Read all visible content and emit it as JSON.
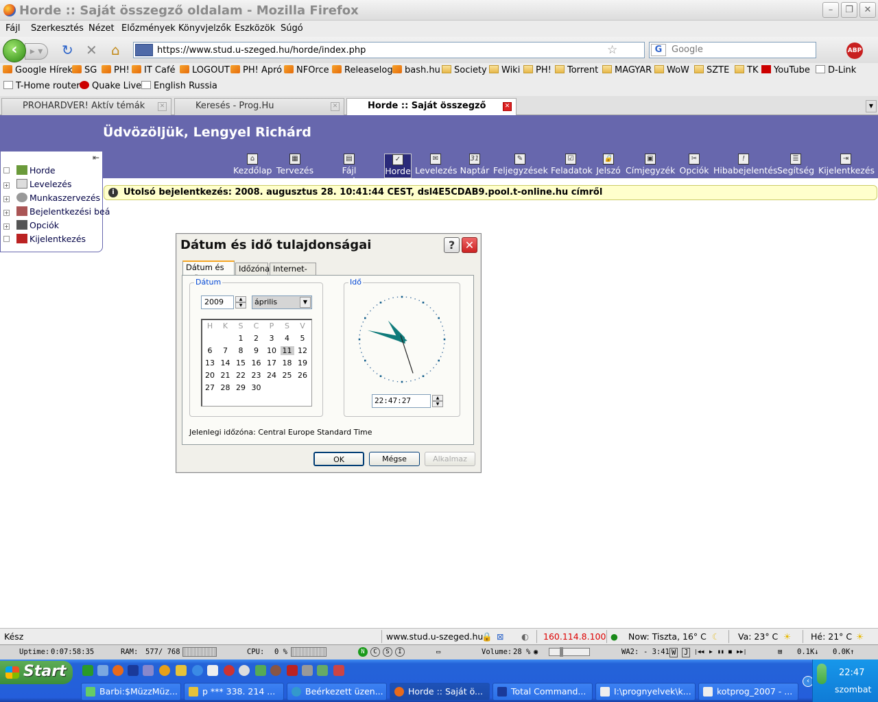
{
  "window": {
    "title": "Horde :: Saját összegző oldalam - Mozilla Firefox"
  },
  "menubar": [
    "Fájl",
    "Szerkesztés",
    "Nézet",
    "Előzmények",
    "Könyvjelzők",
    "Eszközök",
    "Súgó"
  ],
  "navbar": {
    "url": "https://www.stud.u-szeged.hu/horde/index.php",
    "search_placeholder": "Google",
    "search_engine": "G",
    "adblock": "ABP"
  },
  "bookmarks_row1": [
    "Google Hírek",
    "SG",
    "PH!",
    "IT Café",
    "LOGOUT",
    "PH! Apró",
    "NFOrce",
    "Releaselog",
    "bash.hu",
    "Society",
    "Wiki",
    "PH!",
    "Torrent",
    "MAGYAR",
    "WoW",
    "SZTE",
    "TK",
    "YouTube",
    "D-Link"
  ],
  "bookmarks_row2": [
    "T-Home router",
    "Quake Live",
    "English Russia"
  ],
  "tabs": [
    "PROHARDVER! Aktív témák",
    "Keresés - Prog.Hu",
    "Horde :: Saját összegző olda..."
  ],
  "horde": {
    "welcome": "Üdvözöljük, Lengyel Richárd",
    "icons": [
      "Kezdőlap",
      "Tervezés",
      "Fájl menedzser",
      "Horde",
      "Levelezés",
      "Naptár",
      "Feljegyzések",
      "Feladatok",
      "Jelszó",
      "Címjegyzék",
      "Opciók",
      "Hibabejelentés",
      "Segítség",
      "Kijelentkezés"
    ],
    "icon_glyphs": [
      "⌂",
      "▦",
      "▤",
      "✓",
      "✉",
      "31",
      "✎",
      "☑",
      "🔒",
      "▣",
      "✂",
      "!",
      "☰",
      "⇥"
    ],
    "sidebar": [
      "Horde",
      "Levelezés",
      "Munkaszervezés",
      "Bejelentkezési beá",
      "Opciók",
      "Kijelentkezés"
    ],
    "notice": "Utolsó bejelentkezés: 2008. augusztus 28. 10:41:44 CEST, dsl4E5CDAB9.pool.t-online.hu címről"
  },
  "dialog": {
    "title": "Dátum és idő tulajdonságai",
    "help": "?",
    "close": "✕",
    "tabs": [
      "Dátum és idő",
      "Időzóna",
      "Internet-idő"
    ],
    "date_group": "Dátum",
    "time_group": "Idő",
    "year": "2009",
    "month": "április",
    "weekdays": [
      "H",
      "K",
      "S",
      "C",
      "P",
      "S",
      "V"
    ],
    "weeks": [
      [
        "",
        "",
        "1",
        "2",
        "3",
        "4",
        "5"
      ],
      [
        "6",
        "7",
        "8",
        "9",
        "10",
        "11",
        "12"
      ],
      [
        "13",
        "14",
        "15",
        "16",
        "17",
        "18",
        "19"
      ],
      [
        "20",
        "21",
        "22",
        "23",
        "24",
        "25",
        "26"
      ],
      [
        "27",
        "28",
        "29",
        "30",
        "",
        "",
        ""
      ]
    ],
    "selected_day": "11",
    "time": "22:47:27",
    "timezone_text": "Jelenlegi időzóna: Central Europe Standard Time",
    "buttons": [
      "OK",
      "Mégse",
      "Alkalmaz"
    ],
    "clock": {
      "hour": 22,
      "minute": 47,
      "second": 27
    }
  },
  "statusbar": {
    "text": "Kész",
    "domain": "www.stud.u-szeged.hu",
    "ip": "160.114.8.100",
    "weather_now": "Now: Tiszta, 16° C",
    "weather_sun": "Va: 23° C",
    "weather_sat": "Hé: 21° C"
  },
  "monitor": {
    "uptime_label": "Uptime:",
    "uptime": "0:07:58:35",
    "ram_label": "RAM:",
    "ram": "577/ 768",
    "cpu_label": "CPU:",
    "cpu": "0 %",
    "nav_letters": [
      "N",
      "C",
      "S",
      "I"
    ],
    "volume_label": "Volume:",
    "volume": "28 %",
    "wa2_label": "WA2:",
    "wa2": "- 3:41",
    "wa2_buttons": [
      "W",
      "J",
      "|◀◀",
      "▶",
      "▮▮",
      "■",
      "▶▶|"
    ],
    "net_down": "0.1K",
    "net_up": "0.0K"
  },
  "taskbar": {
    "start": "Start",
    "items": [
      "Barbi:$MüzzMüz...",
      "p *** 338. 214 ...",
      "Beérkezett üzen...",
      "Horde :: Saját ö...",
      "Total Command...",
      "I:\\prognyelvek\\k...",
      "kotprog_2007 - ..."
    ],
    "clock": "22:47",
    "day": "szombat"
  }
}
